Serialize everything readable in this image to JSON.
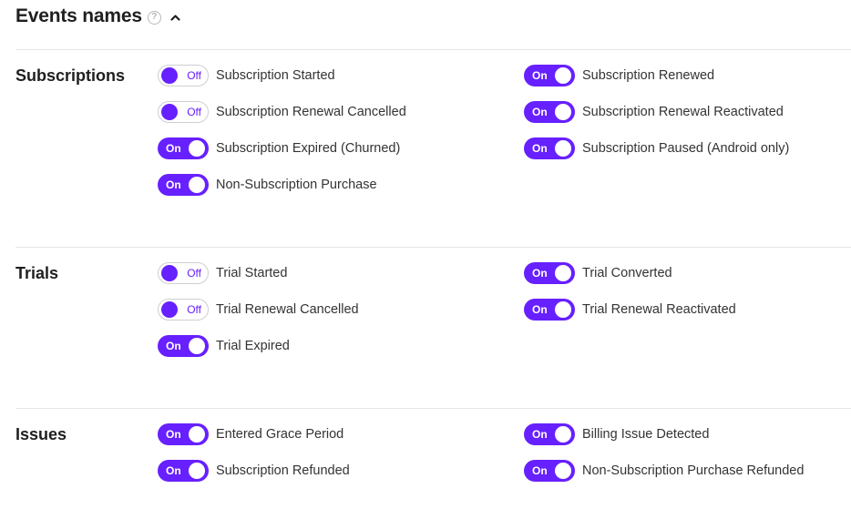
{
  "header": {
    "title": "Events names"
  },
  "colors": {
    "accent": "#6720ff",
    "divider": "#e6e6e6"
  },
  "sections": [
    {
      "title": "Subscriptions",
      "events": [
        {
          "label": "Subscription Started",
          "state": "Off"
        },
        {
          "label": "Subscription Renewed",
          "state": "On"
        },
        {
          "label": "Subscription Renewal Cancelled",
          "state": "Off"
        },
        {
          "label": "Subscription Renewal Reactivated",
          "state": "On"
        },
        {
          "label": "Subscription Expired (Churned)",
          "state": "On"
        },
        {
          "label": "Subscription Paused (Android only)",
          "state": "On"
        },
        {
          "label": "Non-Subscription Purchase",
          "state": "On"
        }
      ]
    },
    {
      "title": "Trials",
      "events": [
        {
          "label": "Trial Started",
          "state": "Off"
        },
        {
          "label": "Trial Converted",
          "state": "On"
        },
        {
          "label": "Trial Renewal Cancelled",
          "state": "Off"
        },
        {
          "label": "Trial Renewal Reactivated",
          "state": "On"
        },
        {
          "label": "Trial Expired",
          "state": "On"
        }
      ]
    },
    {
      "title": "Issues",
      "events": [
        {
          "label": "Entered Grace Period",
          "state": "On"
        },
        {
          "label": "Billing Issue Detected",
          "state": "On"
        },
        {
          "label": "Subscription Refunded",
          "state": "On"
        },
        {
          "label": "Non-Subscription Purchase Refunded",
          "state": "On"
        }
      ]
    }
  ]
}
